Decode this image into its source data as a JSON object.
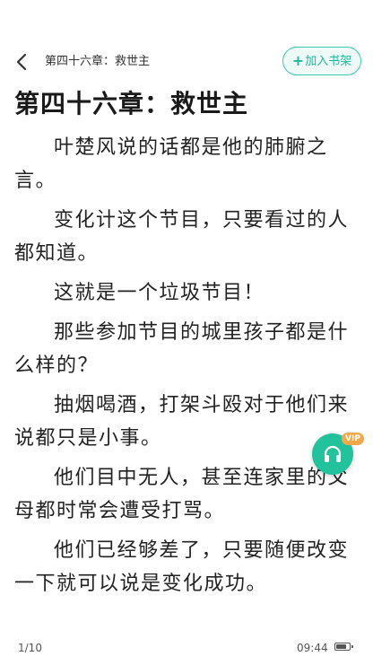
{
  "header": {
    "nav_title": "第四十六章：救世主",
    "add_bookshelf_label": "加入书架",
    "add_bookshelf_symbol": "+"
  },
  "chapter": {
    "title": "第四十六章：救世主",
    "paragraphs": [
      "叶楚风说的话都是他的肺腑之言。",
      "变化计这个节目，只要看过的人都知道。",
      "这就是一个垃圾节目！",
      "那些参加节目的城里孩子都是什么样的？",
      "抽烟喝酒，打架斗殴对于他们来说都只是小事。",
      "他们目中无人，甚至连家里的父母都时常会遭受打骂。",
      "他们已经够差了，只要随便改变一下就可以说是变化成功。"
    ]
  },
  "audio": {
    "icon": "headphones-icon",
    "badge": "VIP",
    "color": "#21c29c",
    "badge_color": "#f3a84a"
  },
  "footer": {
    "page_indicator": "1/10",
    "time": "09:44",
    "battery_level": 0.8
  },
  "colors": {
    "accent": "#1fb89c",
    "text": "#222222",
    "background": "#ffffff"
  }
}
